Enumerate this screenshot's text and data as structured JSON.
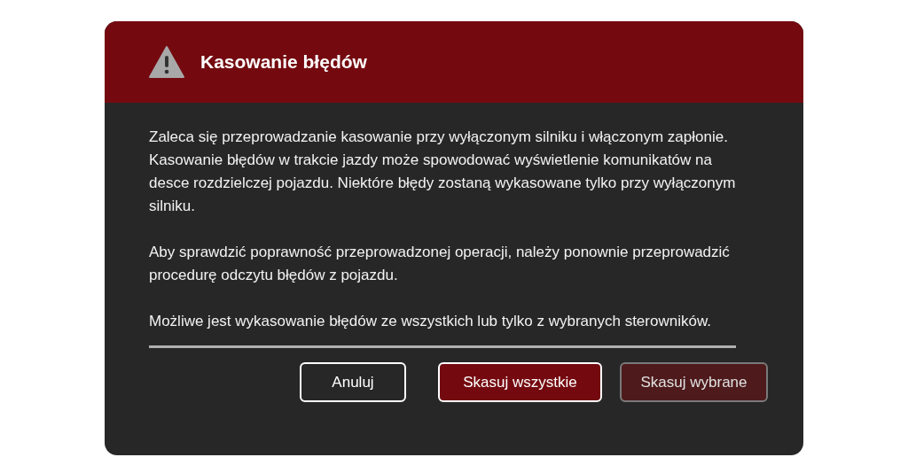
{
  "dialog": {
    "title": "Kasowanie błędów",
    "paragraphs": [
      "Zaleca się przeprowadzanie kasowanie przy wyłączonym silniku i włączonym zapłonie. Kasowanie błędów w trakcie jazdy może spowodować wyświetlenie komunikatów na desce rozdzielczej pojazdu. Niektóre błędy zostaną wykasowane tylko przy wyłączonym silniku.",
      "Aby sprawdzić poprawność przeprowadzonej operacji, należy ponownie przeprowadzić procedurę odczytu błędów z pojazdu.",
      "Możliwe jest wykasowanie błędów ze wszystkich lub tylko z wybranych sterowników."
    ],
    "buttons": [
      {
        "label": "Anuluj",
        "kind": "outline",
        "disabled": false
      },
      {
        "label": "Skasuj wszystkie",
        "kind": "primary",
        "disabled": false
      },
      {
        "label": "Skasuj wybrane",
        "kind": "primary",
        "disabled": true
      }
    ]
  }
}
